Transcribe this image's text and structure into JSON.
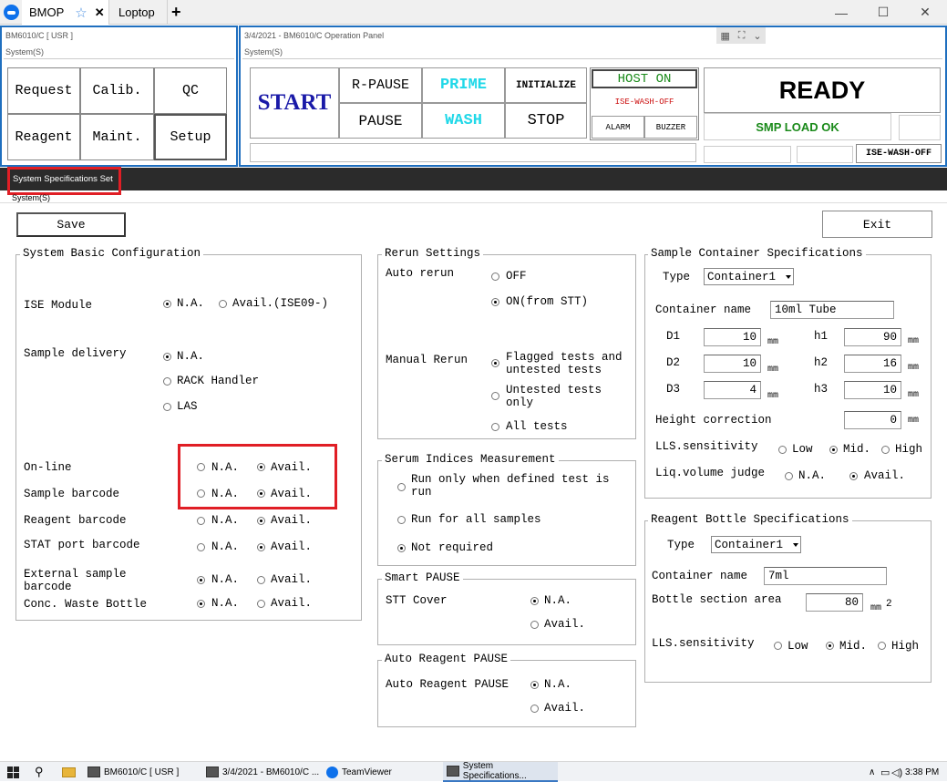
{
  "tabs": {
    "active": "BMOP",
    "second": "Loptop",
    "add": "+"
  },
  "window_controls": {
    "minimize": "—",
    "restore": "☐",
    "close": "✕"
  },
  "left_pane": {
    "title": "BM6010/C [ USR ]",
    "menu": "System(S)",
    "buttons": {
      "request": "Request",
      "calib": "Calib.",
      "qc": "QC",
      "reagent": "Reagent",
      "maint": "Maint.",
      "setup": "Setup"
    }
  },
  "op_pane": {
    "title": "3/4/2021 - BM6010/C Operation Panel",
    "menu": "System(S)",
    "start": "START",
    "rpause": "R-PAUSE",
    "pause": "PAUSE",
    "prime": "PRIME",
    "wash": "WASH",
    "initialize": "INITIALIZE",
    "stop": "STOP",
    "host_on": "HOST ON",
    "ise_wash_off": "ISE-WASH-OFF",
    "alarm": "ALARM",
    "buzzer": "BUZZER",
    "ready": "READY",
    "smp_load": "SMP LOAD OK",
    "ise_wash_off_status": "ISE-WASH-OFF",
    "colors": {
      "start": "#1a1aa8",
      "cyan": "#20d8e8",
      "green": "#1a8a1a",
      "red": "#cc1111"
    }
  },
  "spec_window": {
    "title": "System Specifications Set",
    "menu": "System(S)",
    "save": "Save",
    "exit": "Exit"
  },
  "basic": {
    "title": "System Basic Configuration",
    "ise_module": "ISE Module",
    "ise_opt1": "N.A.",
    "ise_opt2": "Avail.(ISE09-)",
    "sample_delivery": "Sample delivery",
    "sd_opt1": "N.A.",
    "sd_opt2": "RACK Handler",
    "sd_opt3": "LAS",
    "online": "On-line",
    "sample_barcode": "Sample barcode",
    "reagent_barcode": "Reagent barcode",
    "stat_barcode": "STAT port barcode",
    "external_barcode_1": "External sample",
    "external_barcode_2": "barcode",
    "waste": "Conc. Waste Bottle",
    "na": "N.A.",
    "avail": "Avail."
  },
  "rerun": {
    "title": "Rerun Settings",
    "auto": "Auto rerun",
    "off": "OFF",
    "on": "ON(from STT)",
    "manual": "Manual Rerun",
    "flagged_1": "Flagged tests and",
    "flagged_2": "untested tests",
    "untested_1": "Untested tests",
    "untested_2": "only",
    "all": "All tests"
  },
  "serum": {
    "title": "Serum Indices Measurement",
    "opt1_1": "Run only when defined test is",
    "opt1_2": "run",
    "opt2": "Run for all samples",
    "opt3": "Not required"
  },
  "smart_pause": {
    "title": "Smart PAUSE",
    "stt": "STT Cover",
    "na": "N.A.",
    "avail": "Avail."
  },
  "auto_reagent": {
    "title": "Auto Reagent PAUSE",
    "label": "Auto Reagent PAUSE",
    "na": "N.A.",
    "avail": "Avail."
  },
  "sample_container": {
    "title": "Sample Container Specifications",
    "type_label": "Type",
    "type_value": "Container1",
    "name_label": "Container name",
    "name_value": "10ml Tube",
    "d1": "D1",
    "d1_val": "10",
    "d2": "D2",
    "d2_val": "10",
    "d3": "D3",
    "d3_val": "4",
    "h1": "h1",
    "h1_val": "90",
    "h2": "h2",
    "h2_val": "16",
    "h3": "h3",
    "h3_val": "10",
    "mm": "mm",
    "height_corr": "Height correction",
    "height_val": "0",
    "lls": "LLS.sensitivity",
    "low": "Low",
    "mid": "Mid.",
    "high": "High",
    "liq": "Liq.volume judge",
    "na": "N.A.",
    "avail": "Avail."
  },
  "reagent_bottle": {
    "title": "Reagent Bottle Specifications",
    "type_label": "Type",
    "type_value": "Container1",
    "name_label": "Container name",
    "name_value": "7ml",
    "section": "Bottle section area",
    "section_val": "80",
    "unit": "mm",
    "unit_sup": "2",
    "lls": "LLS.sensitivity",
    "low": "Low",
    "mid": "Mid.",
    "high": "High"
  },
  "taskbar": {
    "t1": "BM6010/C [ USR ]",
    "t2": "3/4/2021 - BM6010/C ...",
    "t3": "TeamViewer",
    "t4": "System Specifications...",
    "time": "3:38 PM"
  }
}
